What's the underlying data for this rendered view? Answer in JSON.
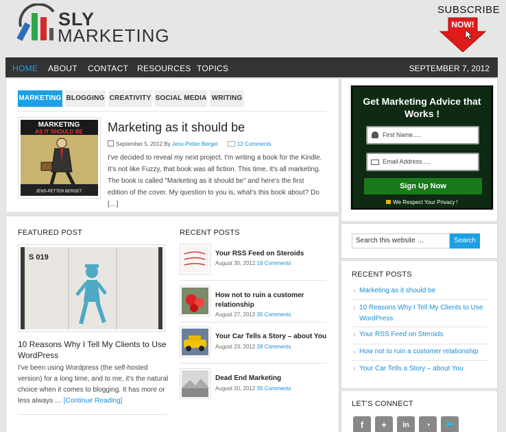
{
  "header": {
    "logo_line1": "SLY",
    "logo_line2": "MARKETING",
    "subscribe_text": "SUBSCRIBE",
    "subscribe_now": "NOW!"
  },
  "nav": {
    "items": [
      "HOME",
      "ABOUT",
      "CONTACT",
      "RESOURCES",
      "TOPICS"
    ],
    "date": "SEPTEMBER 7, 2012"
  },
  "tabs": [
    "MARKETING",
    "BLOGGING",
    "CREATIVITY",
    "SOCIAL MEDIA",
    "WRITING"
  ],
  "article": {
    "title": "Marketing as it should be",
    "date": "September 5, 2012",
    "by": "By",
    "author": "Jens-Petter Berget",
    "comments": "12 Comments",
    "excerpt": "I've decided to reveal my next project. I'm writing a book for the Kindle. It's not like Fuzzy, that book was all fiction. This time, it's all marketing. The book is called \"Marketing as it should be\" and here's the first edition of the cover. My question to you is, what's this book about? Do […]",
    "cover_title1": "MARKETING",
    "cover_title2": "AS IT SHOULD BE",
    "cover_author": "JENS-PETTER BERGET"
  },
  "featured": {
    "section_title": "FEATURED POST",
    "image_label": "S 019",
    "title": "10 Reasons Why I Tell My Clients to Use WordPress",
    "excerpt": "I've been using Wordpress (the self-hosted version) for a long time, and to me, it's the natural choice when it comes to blogging. It has more or less always …",
    "continue": "[Continue Reading]"
  },
  "recent_posts": {
    "section_title": "RECENT POSTS",
    "items": [
      {
        "title": "Your RSS Feed on Steroids",
        "date": "August 30, 2012",
        "comments": "16 Comments"
      },
      {
        "title": "How not to ruin a customer relationship",
        "date": "August 27, 2012",
        "comments": "35 Comments"
      },
      {
        "title": "Your Car Tells a Story – about You",
        "date": "August 23, 2012",
        "comments": "28 Comments"
      },
      {
        "title": "Dead End Marketing",
        "date": "August 20, 2012",
        "comments": "35 Comments"
      }
    ]
  },
  "optin": {
    "title": "Get Marketing Advice that Works !",
    "first_name_placeholder": "First Name.....",
    "email_placeholder": "Email Address.....",
    "button": "Sign Up Now",
    "privacy": "We Respect Your Privacy !"
  },
  "search": {
    "placeholder": "Search this website …",
    "button": "Search"
  },
  "sidebar_recent": {
    "title": "RECENT POSTS",
    "items": [
      "Marketing as it should be",
      "10 Reasons Why I Tell My Clients to Use WordPress",
      "Your RSS Feed on Steroids",
      "How not to ruin a customer relationship",
      "Your Car Tells a Story – about You"
    ]
  },
  "connect": {
    "title": "LET'S CONNECT",
    "icons": [
      "facebook-icon",
      "google-plus-icon",
      "linkedin-icon",
      "rss-icon",
      "twitter-icon"
    ],
    "glyphs": [
      "f",
      "+",
      "in",
      "◔",
      "🐦"
    ]
  },
  "colors": {
    "accent": "#1da0e4",
    "nav_bg": "#333333",
    "optin_bg": "#0e2a12",
    "signup_green": "#197a1b",
    "subscribe_red": "#e01b1b"
  }
}
